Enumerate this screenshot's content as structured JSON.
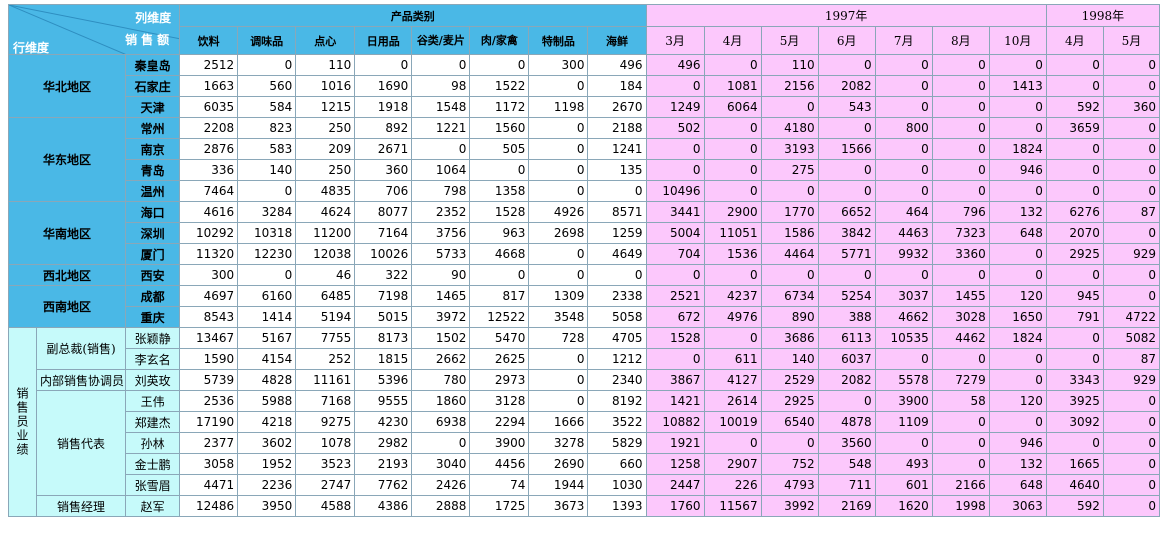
{
  "header": {
    "corner_col": "列维度",
    "corner_sales": "销售额",
    "corner_row": "行维度",
    "group_products": "产品类别",
    "group_1997": "1997年",
    "group_1998": "1998年",
    "products": [
      "饮料",
      "调味品",
      "点心",
      "日用品",
      "谷类/麦片",
      "肉/家禽",
      "特制品",
      "海鲜"
    ],
    "months_1997": [
      "3月",
      "4月",
      "5月",
      "6月",
      "7月",
      "8月",
      "10月"
    ],
    "months_1998": [
      "4月",
      "5月"
    ]
  },
  "regions": [
    {
      "name": "华北地区",
      "rows": [
        {
          "label": "秦皇岛",
          "products": [
            2512,
            0,
            110,
            0,
            0,
            0,
            300,
            496
          ],
          "months": [
            496,
            0,
            110,
            0,
            0,
            0,
            0,
            0,
            0
          ]
        },
        {
          "label": "石家庄",
          "products": [
            1663,
            560,
            1016,
            1690,
            98,
            1522,
            0,
            184
          ],
          "months": [
            0,
            1081,
            2156,
            2082,
            0,
            0,
            1413,
            0,
            0
          ]
        },
        {
          "label": "天津",
          "products": [
            6035,
            584,
            1215,
            1918,
            1548,
            1172,
            1198,
            2670
          ],
          "months": [
            1249,
            6064,
            0,
            543,
            0,
            0,
            0,
            592,
            360
          ]
        }
      ]
    },
    {
      "name": "华东地区",
      "rows": [
        {
          "label": "常州",
          "products": [
            2208,
            823,
            250,
            892,
            1221,
            1560,
            0,
            2188
          ],
          "months": [
            502,
            0,
            4180,
            0,
            800,
            0,
            0,
            3659,
            0
          ]
        },
        {
          "label": "南京",
          "products": [
            2876,
            583,
            209,
            2671,
            0,
            505,
            0,
            1241
          ],
          "months": [
            0,
            0,
            3193,
            1566,
            0,
            0,
            1824,
            0,
            0
          ]
        },
        {
          "label": "青岛",
          "products": [
            336,
            140,
            250,
            360,
            1064,
            0,
            0,
            135
          ],
          "months": [
            0,
            0,
            275,
            0,
            0,
            0,
            946,
            0,
            0
          ]
        },
        {
          "label": "温州",
          "products": [
            7464,
            0,
            4835,
            706,
            798,
            1358,
            0,
            0
          ],
          "months": [
            10496,
            0,
            0,
            0,
            0,
            0,
            0,
            0,
            0
          ]
        }
      ]
    },
    {
      "name": "华南地区",
      "rows": [
        {
          "label": "海口",
          "products": [
            4616,
            3284,
            4624,
            8077,
            2352,
            1528,
            4926,
            8571
          ],
          "months": [
            3441,
            2900,
            1770,
            6652,
            464,
            796,
            132,
            6276,
            87
          ]
        },
        {
          "label": "深圳",
          "products": [
            10292,
            10318,
            11200,
            7164,
            3756,
            963,
            2698,
            1259
          ],
          "months": [
            5004,
            11051,
            1586,
            3842,
            4463,
            7323,
            648,
            2070,
            0
          ]
        },
        {
          "label": "厦门",
          "products": [
            11320,
            12230,
            12038,
            10026,
            5733,
            4668,
            0,
            4649
          ],
          "months": [
            704,
            1536,
            4464,
            5771,
            9932,
            3360,
            0,
            2925,
            929
          ]
        }
      ]
    },
    {
      "name": "西北地区",
      "rows": [
        {
          "label": "西安",
          "products": [
            300,
            0,
            46,
            322,
            90,
            0,
            0,
            0
          ],
          "months": [
            0,
            0,
            0,
            0,
            0,
            0,
            0,
            0,
            0
          ]
        }
      ]
    },
    {
      "name": "西南地区",
      "rows": [
        {
          "label": "成都",
          "products": [
            4697,
            6160,
            6485,
            7198,
            1465,
            817,
            1309,
            2338
          ],
          "months": [
            2521,
            4237,
            6734,
            5254,
            3037,
            1455,
            120,
            945,
            0
          ]
        },
        {
          "label": "重庆",
          "products": [
            8543,
            1414,
            5194,
            5015,
            3972,
            12522,
            3548,
            5058
          ],
          "months": [
            672,
            4976,
            890,
            388,
            4662,
            3028,
            1650,
            791,
            4722
          ]
        }
      ]
    }
  ],
  "sales": {
    "title": "销售员业绩",
    "groups": [
      {
        "name": "副总裁(销售)",
        "rows": [
          {
            "label": "张颖静",
            "products": [
              13467,
              5167,
              7755,
              8173,
              1502,
              5470,
              728,
              4705
            ],
            "months": [
              1528,
              0,
              3686,
              6113,
              10535,
              4462,
              1824,
              0,
              5082
            ]
          },
          {
            "label": "李玄名",
            "products": [
              1590,
              4154,
              252,
              1815,
              2662,
              2625,
              0,
              1212
            ],
            "months": [
              0,
              611,
              140,
              6037,
              0,
              0,
              0,
              0,
              87
            ]
          }
        ]
      },
      {
        "name": "内部销售协调员",
        "rows": [
          {
            "label": "刘英玫",
            "products": [
              5739,
              4828,
              11161,
              5396,
              780,
              2973,
              0,
              2340
            ],
            "months": [
              3867,
              4127,
              2529,
              2082,
              5578,
              7279,
              0,
              3343,
              929
            ]
          }
        ]
      },
      {
        "name": "销售代表",
        "rows": [
          {
            "label": "王伟",
            "products": [
              2536,
              5988,
              7168,
              9555,
              1860,
              3128,
              0,
              8192
            ],
            "months": [
              1421,
              2614,
              2925,
              0,
              3900,
              58,
              120,
              3925,
              0
            ]
          },
          {
            "label": "郑建杰",
            "products": [
              17190,
              4218,
              9275,
              4230,
              6938,
              2294,
              1666,
              3522
            ],
            "months": [
              10882,
              10019,
              6540,
              4878,
              1109,
              0,
              0,
              3092,
              0
            ]
          },
          {
            "label": "孙林",
            "products": [
              2377,
              3602,
              1078,
              2982,
              0,
              3900,
              3278,
              5829
            ],
            "months": [
              1921,
              0,
              0,
              3560,
              0,
              0,
              946,
              0,
              0
            ]
          },
          {
            "label": "金士鹏",
            "products": [
              3058,
              1952,
              3523,
              2193,
              3040,
              4456,
              2690,
              660
            ],
            "months": [
              1258,
              2907,
              752,
              548,
              493,
              0,
              132,
              1665,
              0
            ]
          },
          {
            "label": "张雪眉",
            "products": [
              4471,
              2236,
              2747,
              7762,
              2426,
              74,
              1944,
              1030
            ],
            "months": [
              2447,
              226,
              4793,
              711,
              601,
              2166,
              648,
              4640,
              0
            ]
          }
        ]
      },
      {
        "name": "销售经理",
        "rows": [
          {
            "label": "赵军",
            "products": [
              12486,
              3950,
              4588,
              4386,
              2888,
              1725,
              3673,
              1393
            ],
            "months": [
              1760,
              11567,
              3992,
              2169,
              1620,
              1998,
              3063,
              592,
              0
            ]
          }
        ]
      }
    ]
  },
  "colors": {
    "header_blue": "#4ab8e6",
    "date_pink": "#fcc8fc",
    "sales_cyan": "#c6fafa"
  }
}
